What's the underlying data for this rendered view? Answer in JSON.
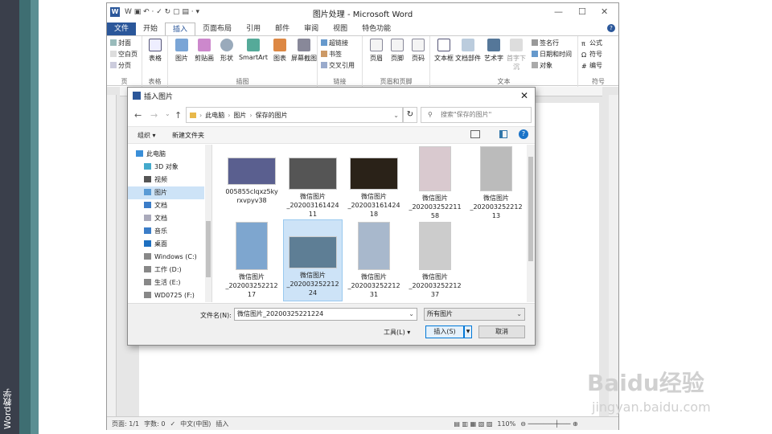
{
  "side_text": "Word教学",
  "word": {
    "title": "图片处理 - Microsoft Word",
    "qat": "W  ▣ ↶ · ✓ ↻ ▢ ▤ · ▾",
    "tabs": [
      "文件",
      "开始",
      "页面布局",
      "引用",
      "邮件",
      "审阅",
      "视图",
      "特色功能"
    ],
    "active_tab": "插入",
    "groups": {
      "page": {
        "label": "页",
        "items": [
          "封面",
          "空白页",
          "分页"
        ]
      },
      "table": {
        "label": "表格",
        "btn": "表格"
      },
      "illus": {
        "label": "插图",
        "btns": [
          "图片",
          "剪贴画",
          "形状",
          "SmartArt",
          "图表",
          "屏幕截图"
        ]
      },
      "links": {
        "label": "链接",
        "items": [
          "超链接",
          "书签",
          "交叉引用"
        ]
      },
      "hf": {
        "label": "页眉和页脚",
        "btns": [
          "页眉",
          "页脚",
          "页码"
        ]
      },
      "text": {
        "label": "文本",
        "btns": [
          "文本框",
          "文档部件",
          "艺术字",
          "首字下沉"
        ],
        "items": [
          "签名行",
          "日期和时间",
          "对象"
        ]
      },
      "sym": {
        "label": "符号",
        "items": [
          "公式",
          "符号",
          "编号"
        ]
      }
    },
    "status": {
      "page": "页面: 1/1",
      "words": "字数: 0",
      "lang": "中文(中国)",
      "mode": "插入",
      "zoom": "110%"
    }
  },
  "dialog": {
    "title": "插入图片",
    "breadcrumb": [
      "此电脑",
      "图片",
      "保存的图片"
    ],
    "search_placeholder": "搜索\"保存的图片\"",
    "organize": "组织 ▾",
    "new_folder": "新建文件夹",
    "nav": [
      "此电脑",
      "3D 对象",
      "视频",
      "图片",
      "文档",
      "文档",
      "音乐",
      "桌面",
      "Windows (C:)",
      "工作 (D:)",
      "生活 (E:)",
      "WD0725 (F:)"
    ],
    "selected_nav": "图片",
    "files": [
      {
        "name": "005855clqxz5kyrxvpyv38",
        "l1": "005855clqxz5ky",
        "l2": "rxvpyv38",
        "l3": "",
        "color": "#5a5f8f"
      },
      {
        "name": "微信图片_2020031614241 1",
        "l1": "微信图片",
        "l2": "_202003161424",
        "l3": "11",
        "color": "#555"
      },
      {
        "name": "微信图片_2020031614241 8",
        "l1": "微信图片",
        "l2": "_202003161424",
        "l3": "18",
        "color": "#2a2218"
      },
      {
        "name": "微信图片_2020032522115 8",
        "l1": "微信图片",
        "l2": "_202003252211",
        "l3": "58",
        "color": "#d9c9cf"
      },
      {
        "name": "微信图片_2020032522121 3",
        "l1": "微信图片",
        "l2": "_202003252212",
        "l3": "13",
        "color": "#bbb"
      },
      {
        "name": "微信图片_2020032522121 7",
        "l1": "微信图片",
        "l2": "_202003252212",
        "l3": "17",
        "color": "#7ea6cf"
      },
      {
        "name": "微信图片_2020032522122 4",
        "l1": "微信图片",
        "l2": "_202003252212",
        "l3": "24",
        "color": "#5e7e95"
      },
      {
        "name": "微信图片_2020032522123 1",
        "l1": "微信图片",
        "l2": "_202003252212",
        "l3": "31",
        "color": "#a8b8cc"
      },
      {
        "name": "微信图片_2020032522123 7",
        "l1": "微信图片",
        "l2": "_202003252212",
        "l3": "37",
        "color": "#ccc"
      }
    ],
    "filename_label": "文件名(N):",
    "filename_value": "微信图片_20200325221224",
    "filetype": "所有图片",
    "tools": "工具(L)",
    "insert": "插入(S)",
    "cancel": "取消"
  },
  "watermark": {
    "main": "Baidu经验",
    "sub": "jingyan.baidu.com"
  }
}
